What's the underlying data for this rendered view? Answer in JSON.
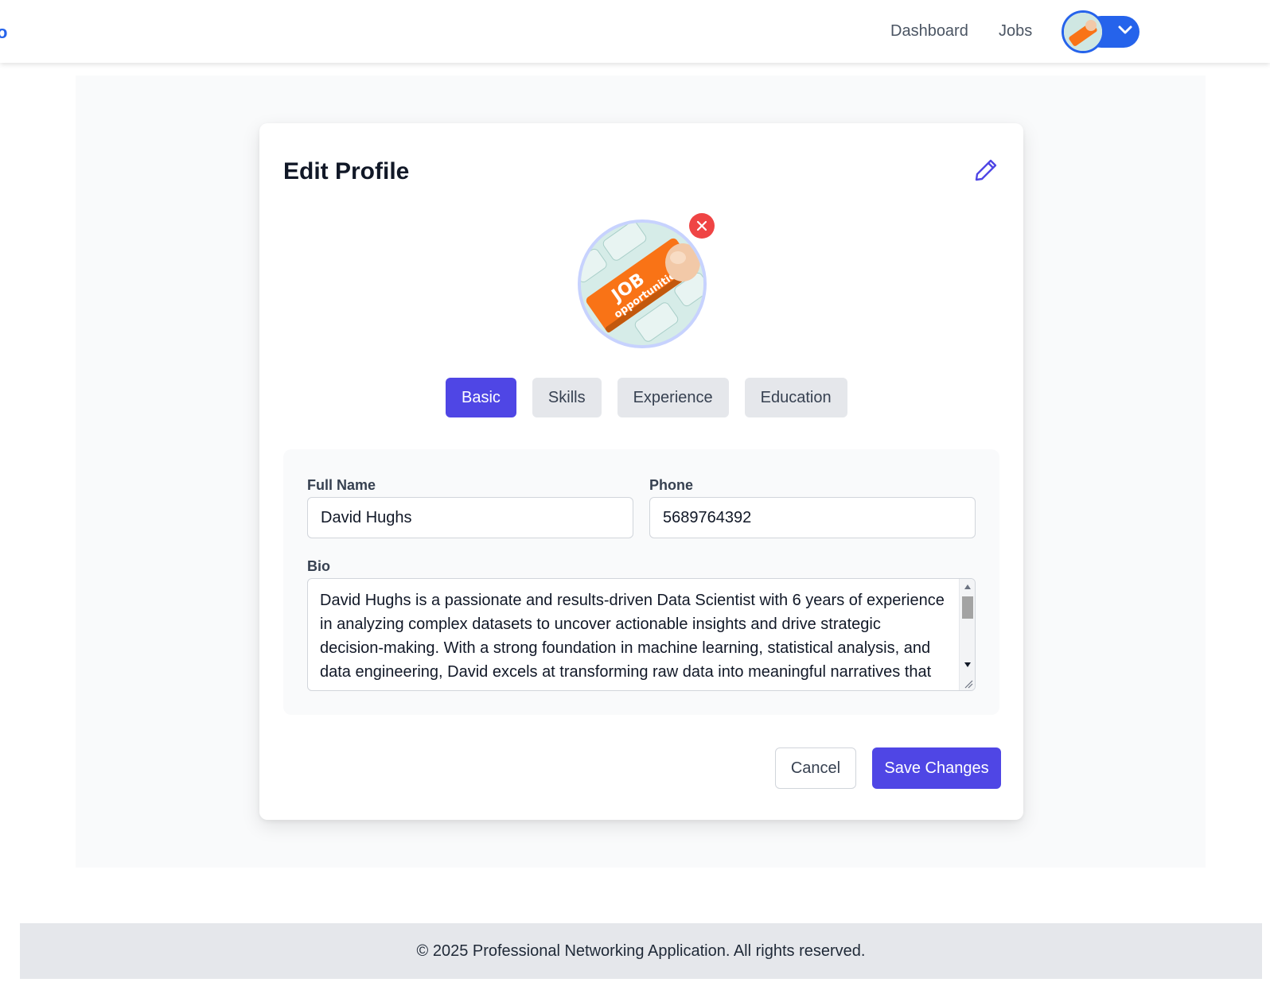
{
  "header": {
    "brand_fragment": "o",
    "nav": {
      "dashboard": "Dashboard",
      "jobs": "Jobs"
    },
    "avatar_icon": "profile-avatar",
    "dropdown_icon": "chevron-down-icon",
    "accent_color": "#2563eb"
  },
  "card": {
    "title": "Edit Profile",
    "edit_icon": "pencil-icon",
    "photo": {
      "keycap_text_main": "JOB",
      "keycap_text_sub": "opportunities",
      "remove_icon": "close-icon"
    },
    "tabs": [
      {
        "label": "Basic",
        "active": true
      },
      {
        "label": "Skills",
        "active": false
      },
      {
        "label": "Experience",
        "active": false
      },
      {
        "label": "Education",
        "active": false
      }
    ],
    "form": {
      "full_name": {
        "label": "Full Name",
        "value": "David Hughs"
      },
      "phone": {
        "label": "Phone",
        "value": "5689764392"
      },
      "bio": {
        "label": "Bio",
        "value": "David Hughs is a passionate and results-driven Data Scientist with  6 years of experience in analyzing complex datasets to uncover actionable insights and drive strategic decision-making. With a strong foundation in machine learning, statistical analysis, and data engineering, David excels at transforming raw data into meaningful narratives that"
      }
    },
    "actions": {
      "cancel": "Cancel",
      "save": "Save Changes"
    },
    "primary_color": "#4f46e5",
    "danger_color": "#ef4444"
  },
  "footer": {
    "text": "© 2025 Professional Networking Application. All rights reserved."
  }
}
